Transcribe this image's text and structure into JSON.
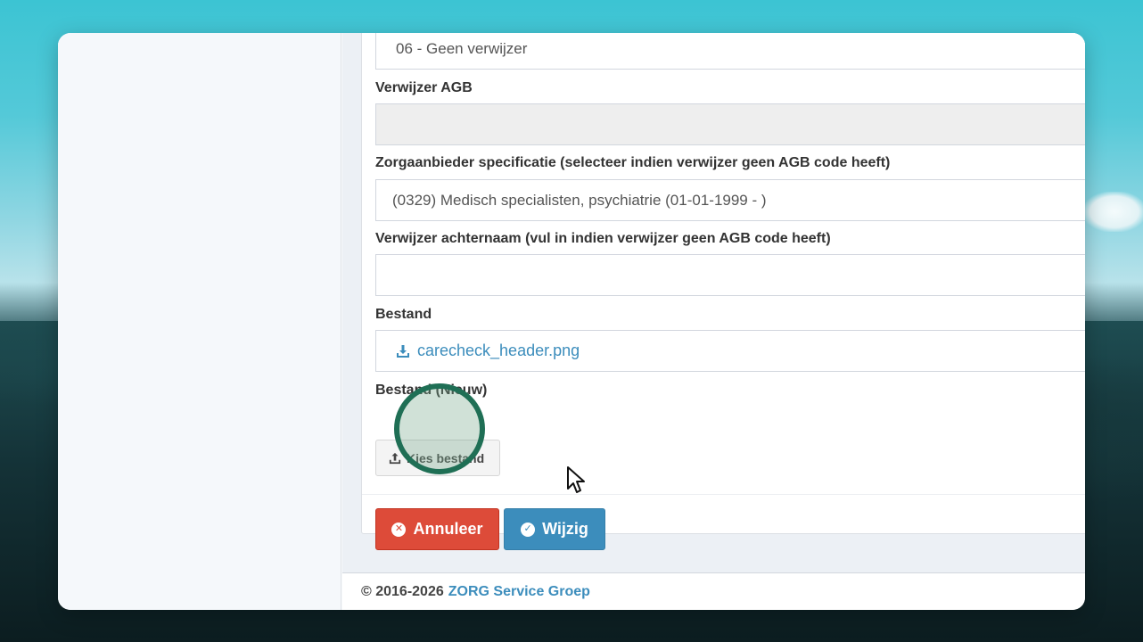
{
  "form": {
    "referral_type_value": "06 - Geen verwijzer",
    "referrer_agb_label": "Verwijzer AGB",
    "referrer_agb_value": "",
    "provider_spec_label": "Zorgaanbieder specificatie (selecteer indien verwijzer geen AGB code heeft)",
    "provider_spec_value": "(0329) Medisch specialisten, psychiatrie (01-01-1999 - )",
    "referrer_lastname_label": "Verwijzer achternaam (vul in indien verwijzer geen AGB code heeft)",
    "referrer_lastname_value": "",
    "file_label": "Bestand",
    "file_name": "carecheck_header.png",
    "file_new_label": "Bestand (Nieuw)",
    "choose_file_label": "Kies bestand"
  },
  "actions": {
    "cancel_label": "Annuleer",
    "save_label": "Wijzig"
  },
  "footer": {
    "copyright": "© 2016-2026",
    "company": "ZORG Service Groep"
  },
  "icons": {
    "download": "download-icon",
    "upload": "upload-icon",
    "cancel": "times-circle-icon",
    "save": "check-circle-icon",
    "cursor": "mouse-pointer-icon"
  },
  "colors": {
    "primary": "#3c8dbc",
    "danger": "#dd4b39",
    "highlight": "#1f6f55"
  }
}
